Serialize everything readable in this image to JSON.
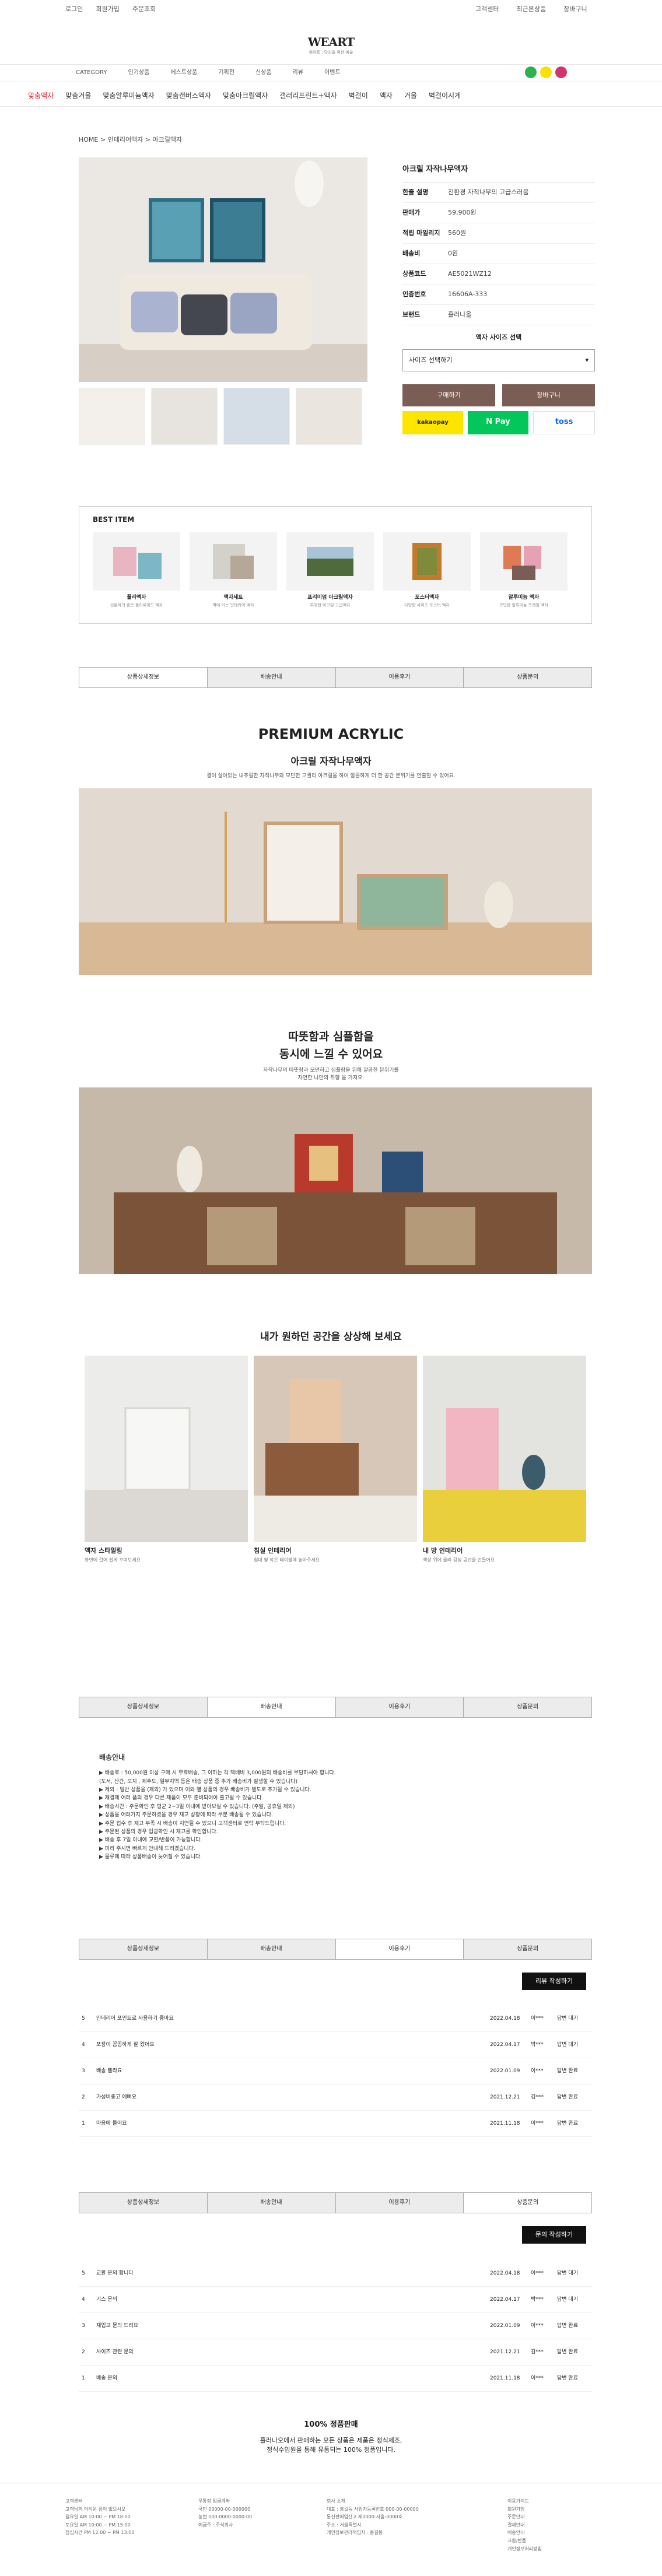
{
  "topbar": {
    "left": [
      "로그인",
      "회원가입",
      "주문조회"
    ],
    "right": [
      "고객센터",
      "최근본상품",
      "장바구니"
    ]
  },
  "logo": {
    "main": "WEART",
    "sub": "위아트 : 당신을 위한 예술"
  },
  "nav1": [
    "CATEGORY",
    "인기상품",
    "베스트상품",
    "기획전",
    "신상품",
    "리뷰",
    "이벤트"
  ],
  "nav2": [
    "맞춤액자",
    "맞춤거울",
    "맞춤알루미늄액자",
    "맞춤캔버스액자",
    "맞춤아크릴액자",
    "갤러리프린트+액자",
    "벽걸이",
    "액자",
    "거울",
    "벽걸이시계"
  ],
  "breadcrumb": "HOME > 인테리어액자 > 아크릴액자",
  "product": {
    "title": "아크릴 자작나무액자",
    "rows": [
      {
        "k": "한줄 설명",
        "v": "천환경 자작나무의 고급스러움"
      },
      {
        "k": "판매가",
        "v": "59,900원"
      },
      {
        "k": "적립 마일리지",
        "v": "560원"
      },
      {
        "k": "배송비",
        "v": "0원"
      },
      {
        "k": "상품코드",
        "v": "AE5021WZ12"
      },
      {
        "k": "인증번호",
        "v": "16606A-333"
      },
      {
        "k": "브랜드",
        "v": "흘러나올"
      }
    ],
    "option_title": "액자 사이즈 선택",
    "option_value": "사이즈 선택하기",
    "buy_label": "구매하기",
    "cart_label": "장바구니",
    "pays": [
      "kakaopay",
      "N Pay",
      "toss"
    ]
  },
  "best": {
    "title": "BEST ITEM",
    "items": [
      {
        "name": "폴라액자",
        "desc": "선물하기 좋은 폴라로이드 액자"
      },
      {
        "name": "액자세트",
        "desc": "벽에 거는 인테리어 액자"
      },
      {
        "name": "프리미엄 아크릴액자",
        "desc": "투명한 아크릴 고급액자"
      },
      {
        "name": "포스터액자",
        "desc": "다양한 사이즈 포스터 액자"
      },
      {
        "name": "알루미늄 액자",
        "desc": "모던한 알루미늄 프레임 액자"
      }
    ]
  },
  "tabs": [
    "상품상세정보",
    "배송안내",
    "이용후기",
    "상품문의"
  ],
  "detail": {
    "h1": "PREMIUM ACRYLIC",
    "h2": "아크릴 자작나무액자",
    "p1": "결이 살아있는 내추럴한 자작나무와 모던한 고퀄리 아크릴을 하여 깔끔하게 더 한 공간 분위기를 연출할 수 있어요.",
    "h3a": "따뜻함과 심플함을",
    "h3b": "동시에 느낄 수 있어요",
    "p2a": "자작나무의 따뜻함과 모던하고 심플함을 위해 깔끔한 분위기를",
    "p2b": "자연한 나만의 취향 을 가져요.",
    "h4": "내가 원하던 공간을 상상해 보세요",
    "spaces": [
      {
        "title": "액자 스타일링",
        "desc": "화면에 걸어 쉽게 꾸며보세요"
      },
      {
        "title": "침실 인테리어",
        "desc": "침대 옆 작은 테이블에 놓아주세요"
      },
      {
        "title": "내 방 인테리어",
        "desc": "책상 위에 올려 감성 공간을 만들어요"
      }
    ]
  },
  "shipping": {
    "title": "배송안내",
    "lines": [
      "▶ 배송료 : 50,000원 이상 구매 시 무료배송, 그 이하는 각 택배비 3,000원의 배송비를 부담하셔야 합니다.",
      "(도서, 산간, 오지 , 제주도, 일부지역 등은 배송 상품 중 추가 배송비가 발생할 수 있습니다)",
      "▶ 제외 : 일반 상품을 (제외) 가 있으며 이와 별 상품의 경우 배송비가 별도로 추가될 수 있습니다.",
      "▶ 재결제 여러 품의 경우 다른 제품이 모두 준비되어야 출고될 수 있습니다.",
      "▶ 배송시간 : 주문확인 후 평균 2~3일 이내에 받아보실 수 있습니다. (주말, 공휴일 제외)",
      "▶ 상품을 어려가지 주문하셨을 경우 재고 상황에 따라 부분 배송될 수 있습니다.",
      "▶ 주문 접수 후 재고 부족 시 배송이 지연될 수 있으니 고객센터로 연락 부탁드립니다.",
      "▶ 주문된 상품의 경우 입금확인 시 재고를 확인합니다.",
      "▶ 배송 후 7일 이내에 교환/반품이 가능합니다.",
      "▶ 미리 주시면 빠르게 안내해 드리겠습니다.",
      "▶ 물류에 따라 상품배송이 늦어질 수 있습니다."
    ]
  },
  "reviews": {
    "write_label": "리뷰 작성하기",
    "items": [
      {
        "no": "5",
        "title": "인테리어 포인트로 사용하기 좋아요",
        "date": "2022.04.18",
        "author": "이***",
        "state": "답변 대기"
      },
      {
        "no": "4",
        "title": "포장이 꼼꼼하게 잘 왔어요",
        "date": "2022.04.17",
        "author": "박***",
        "state": "답변 대기"
      },
      {
        "no": "3",
        "title": "배송 빨라요",
        "date": "2022.01.09",
        "author": "이***",
        "state": "답변 완료"
      },
      {
        "no": "2",
        "title": "가성비좋고 예뻐요",
        "date": "2021.12.21",
        "author": "김***",
        "state": "답변 완료"
      },
      {
        "no": "1",
        "title": "마음에 들어요",
        "date": "2021.11.18",
        "author": "이***",
        "state": "답변 완료"
      }
    ]
  },
  "qna": {
    "write_label": "문의 작성하기",
    "items": [
      {
        "no": "5",
        "title": "교환 문의 합니다",
        "date": "2022.04.18",
        "author": "이***",
        "state": "답변 대기"
      },
      {
        "no": "4",
        "title": "기스 문의",
        "date": "2022.04.17",
        "author": "박***",
        "state": "답변 대기"
      },
      {
        "no": "3",
        "title": "재입고 문의 드려요",
        "date": "2022.01.09",
        "author": "이***",
        "state": "답변 완료"
      },
      {
        "no": "2",
        "title": "사이즈 관련 문의",
        "date": "2021.12.21",
        "author": "김***",
        "state": "답변 완료"
      },
      {
        "no": "1",
        "title": "배송 문의",
        "date": "2021.11.18",
        "author": "이***",
        "state": "답변 완료"
      }
    ]
  },
  "guarantee": {
    "title": "100% 정품판매",
    "l1": "흘러나오에서 판매하는 모든 상품은 제품은 정식제조,",
    "l2": "정식수입원을 통해 유통되는 100% 정품입니다."
  },
  "footer": {
    "c1": [
      "고객센터",
      "고객님의 어려운 점이 없으시오",
      "월요일 AM 10:00 ~ PM 18:00",
      "토요일 AM 10:00 ~ PM 15:00",
      "점심시간 PM 12:00 ~ PM 13:00"
    ],
    "c2": [
      "무통장 입금계좌",
      "국민 00000-00-000000",
      "농협 000-0000-0000-00",
      "예금주 : 주식회사"
    ],
    "c3": [
      "회사 소개",
      "대표 : 홍길동 사업자등록번호 000-00-00000",
      "통신판매업신고 제0000-서울-0000호",
      "주소 : 서울특별시",
      "개인정보관리책임자 : 홍길동"
    ],
    "c4": [
      "이용가이드",
      "회원가입",
      "주문안내",
      "결제안내",
      "배송안내",
      "교환/반품",
      "개인정보처리방침"
    ]
  }
}
